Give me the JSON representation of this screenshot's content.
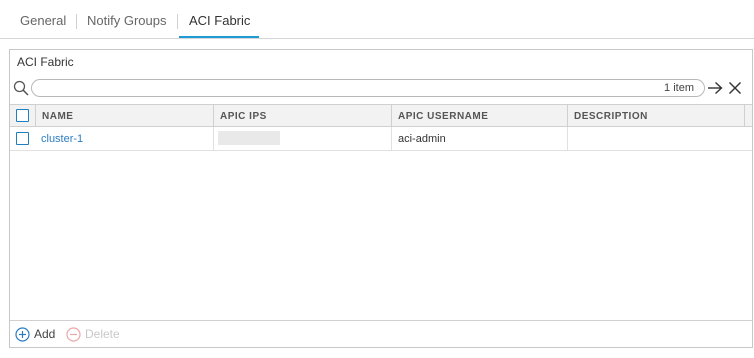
{
  "tabs": [
    {
      "label": "General"
    },
    {
      "label": "Notify Groups"
    },
    {
      "label": "ACI Fabric",
      "active": true
    }
  ],
  "panel": {
    "title": "ACI Fabric"
  },
  "search": {
    "value": "",
    "placeholder": "",
    "count_text": "1 item"
  },
  "icons": {
    "search": "search-icon",
    "apply": "arrow-right-icon",
    "clear": "close-icon",
    "add": "plus-circle-icon",
    "delete": "minus-circle-icon"
  },
  "table": {
    "columns": [
      "NAME",
      "APIC IPS",
      "APIC USERNAME",
      "DESCRIPTION"
    ],
    "rows": [
      {
        "name": "cluster-1",
        "apic_ips": "",
        "apic_username": "aci-admin",
        "description": ""
      }
    ]
  },
  "footer": {
    "add_label": "Add",
    "delete_label": "Delete"
  },
  "colors": {
    "accent": "#1f9bd7",
    "link": "#2b7cc1",
    "checkbox": "#1f7fc1",
    "disabled": "#c8c8c8"
  }
}
